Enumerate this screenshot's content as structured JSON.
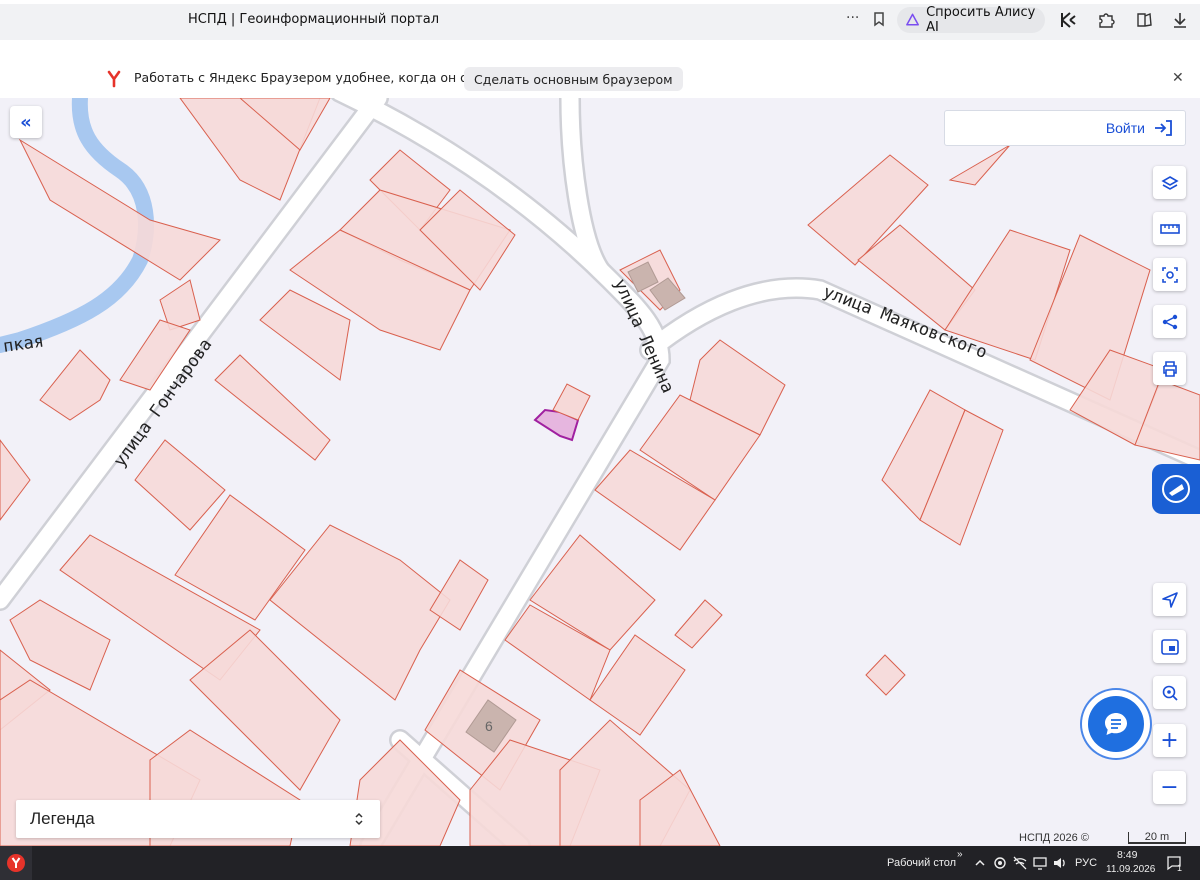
{
  "browser": {
    "tab_title": "НСПД | Геоинформационный портал",
    "more_label": "···",
    "alice_label": "Спросить Алису AI"
  },
  "infobar": {
    "message": "Работать с Яндекс Браузером удобнее, когда он основной",
    "make_default_label": "Сделать основным браузером",
    "close_label": "✕"
  },
  "map": {
    "streets": {
      "goncharova": "улица Гончарова",
      "lenina": "улица Ленина",
      "mayakovskogo": "улица Маяковского",
      "river_fragment": "пкая"
    },
    "building_number": "6",
    "login_label": "Войти",
    "panel_toggle_label": "«",
    "tools": [
      "layers-icon",
      "ruler-icon",
      "select-area-icon",
      "share-icon",
      "print-icon",
      "locate-icon",
      "minimap-icon",
      "search-location-icon",
      "zoom-in-icon",
      "zoom-out-icon"
    ],
    "zoom_in_label": "+",
    "zoom_out_label": "−",
    "copyright": "НСПД 2026 ©",
    "scale_label": "20 m",
    "colors": {
      "parcel_fill": "#f6d9d8",
      "parcel_stroke": "#d9604e",
      "selected_fill": "#e6b6df",
      "selected_stroke": "#a020a0",
      "road": "#ffffff",
      "water": "#a8c8f0",
      "accent": "#1a5fd4"
    }
  },
  "legend": {
    "label": "Легенда"
  },
  "taskbar": {
    "desktop_label": "Рабочий стол",
    "chevron": "»",
    "lang": "РУС",
    "time": "8:49",
    "date": "11.09.2026",
    "notification_count": "1"
  }
}
